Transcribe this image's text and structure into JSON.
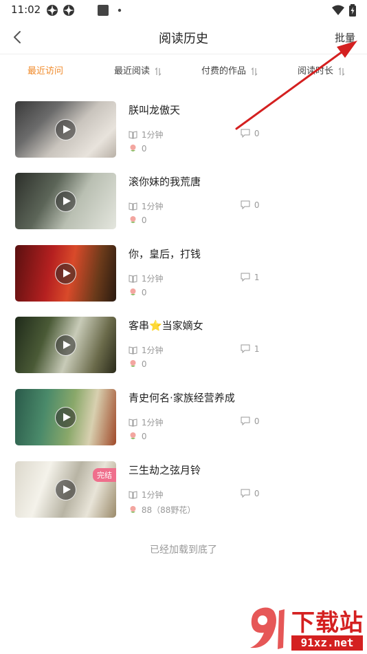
{
  "status_bar": {
    "time": "11:02",
    "icons": [
      "gear-icon",
      "gear-icon",
      "square-icon",
      "dot-icon",
      "wifi-icon",
      "battery-icon"
    ]
  },
  "header": {
    "title": "阅读历史",
    "batch_label": "批量",
    "back_icon": "back-arrow-icon"
  },
  "tabs": [
    {
      "label": "最近访问",
      "active": true,
      "sortable": false
    },
    {
      "label": "最近阅读",
      "active": false,
      "sortable": true
    },
    {
      "label": "付费的作品",
      "active": false,
      "sortable": true
    },
    {
      "label": "阅读时长",
      "active": false,
      "sortable": true
    }
  ],
  "items": [
    {
      "title": "朕叫龙傲天",
      "read_time": "1分钟",
      "comments": "0",
      "flowers": "0",
      "badge": ""
    },
    {
      "title": "滚你妹的我荒唐",
      "read_time": "1分钟",
      "comments": "0",
      "flowers": "0",
      "badge": ""
    },
    {
      "title": "你，皇后，打钱",
      "read_time": "1分钟",
      "comments": "1",
      "flowers": "0",
      "badge": ""
    },
    {
      "title": "客串⭐当家嫡女",
      "read_time": "1分钟",
      "comments": "1",
      "flowers": "0",
      "badge": ""
    },
    {
      "title": "青史何名·家族经营养成",
      "read_time": "1分钟",
      "comments": "0",
      "flowers": "0",
      "badge": ""
    },
    {
      "title": "三生劫之弦月铃",
      "read_time": "1分钟",
      "comments": "0",
      "flowers": "88（88野花）",
      "badge": "完结"
    }
  ],
  "footer": {
    "end_text": "已经加载到底了"
  },
  "watermark": {
    "text_cn": "下载站",
    "text_url": "91xz.net"
  },
  "colors": {
    "accent": "#f08a2a",
    "arrow": "#d42020",
    "badge": "#ef6f8c",
    "muted": "#999999"
  }
}
